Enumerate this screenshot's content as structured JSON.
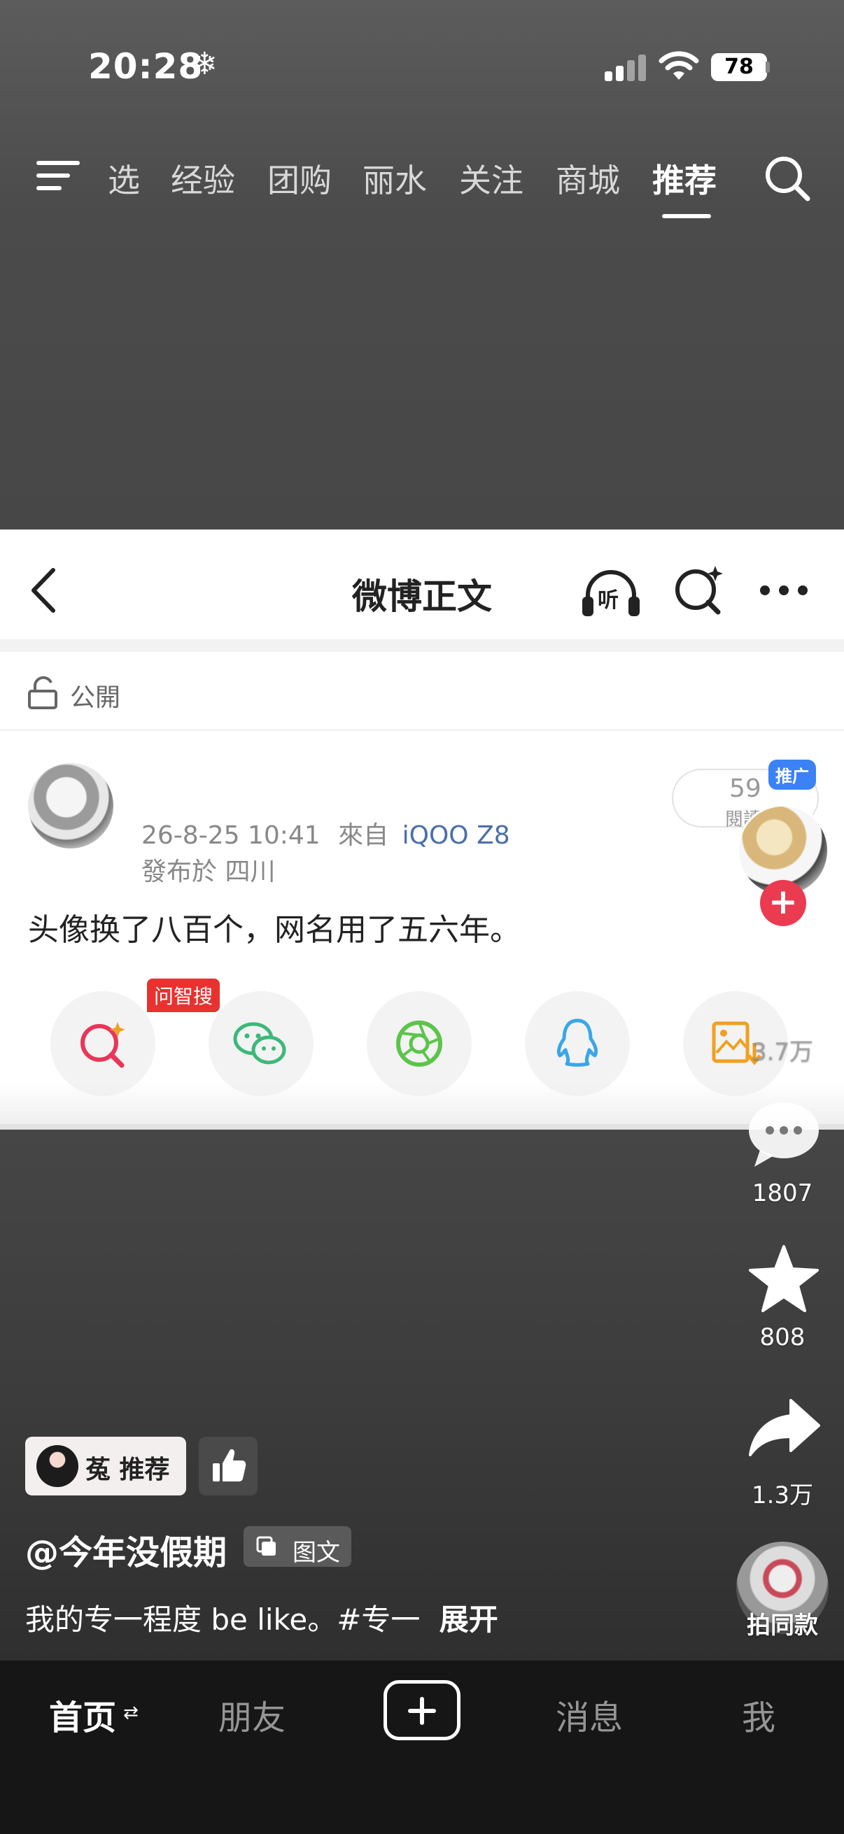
{
  "status_bar": {
    "time": "20:28",
    "mode_icon": "❄",
    "battery": "78"
  },
  "top_nav": {
    "tabs": [
      "选",
      "经验",
      "团购",
      "丽水",
      "关注",
      "商城",
      "推荐"
    ],
    "active_tab": "推荐"
  },
  "card": {
    "title": "微博正文",
    "listen_label": "听",
    "visibility": "公開",
    "timestamp": "26-8-25 10:41",
    "from_label": "來自",
    "device": "iQOO Z8",
    "location": "發布於 四川",
    "read_count": "59",
    "read_label": "閱讀",
    "text": "头像换了八百个，网名用了五六年。",
    "share_badge": "问智搜"
  },
  "rail": {
    "promo_badge": "推广",
    "follow_icon": "+",
    "like_count": "3.7万",
    "comment_count": "1807",
    "favorite_count": "808",
    "share_count": "1.3万",
    "template_label": "拍同款"
  },
  "info": {
    "recommender": "菟 推荐",
    "author": "@今年没假期",
    "type_label": "图文",
    "caption": "我的专一程度 be like。#专一",
    "expand": "展开"
  },
  "tabbar": {
    "home": "首页",
    "home_arrows": "⇄",
    "friends": "朋友",
    "messages": "消息",
    "me": "我"
  },
  "colors": {
    "accent_red": "#ea3b50",
    "device_link": "#4a6fa8",
    "badge_blue": "#3b82f6"
  }
}
